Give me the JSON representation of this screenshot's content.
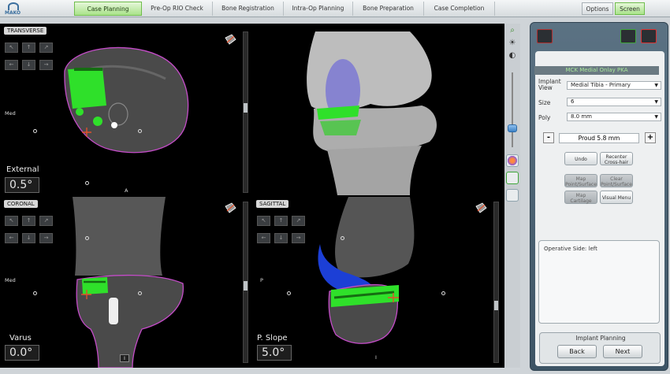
{
  "logo": {
    "text": "MAKO"
  },
  "tabs": [
    {
      "label": "Case Planning",
      "active": true
    },
    {
      "label": "Pre-Op RIO Check",
      "active": false
    },
    {
      "label": "Bone Registration",
      "active": false
    },
    {
      "label": "Intra-Op Planning",
      "active": false
    },
    {
      "label": "Bone Preparation",
      "active": false
    },
    {
      "label": "Case Completion",
      "active": false
    }
  ],
  "top_right": {
    "options_label": "Options",
    "screen_label": "Screen"
  },
  "views": {
    "transverse": {
      "label": "TRANSVERSE",
      "med": "Med",
      "bottom": "A",
      "angle_label": "External",
      "angle_value": "0.5°"
    },
    "coronal": {
      "label": "CORONAL",
      "med": "Med",
      "bottom": "I",
      "angle_label": "Varus",
      "angle_value": "0.0°"
    },
    "sagittal": {
      "label": "SAGITTAL",
      "side": "P",
      "bottom": "I",
      "angle_label": "P. Slope",
      "angle_value": "5.0°"
    }
  },
  "panel": {
    "implant_title": "MCK Medial Onlay PKA",
    "implant_view_label": "Implant View",
    "implant_view_value": "Medial Tibia - Primary",
    "size_label": "Size",
    "size_value": "6",
    "poly_label": "Poly",
    "poly_value": "8.0 mm",
    "minus": "-",
    "plus": "+",
    "proud_value": "Proud 5.8 mm",
    "undo": "Undo",
    "recenter": "Recenter Cross-hair",
    "map_point": "Map Point/Surface",
    "clear_point": "Clear Point/Surface",
    "map_cartilage": "Map Cartilage",
    "visual_menu": "Visual Menu",
    "operative_side": "Operative Side: left",
    "nav_title": "Implant Planning",
    "back": "Back",
    "next": "Next"
  },
  "colors": {
    "implant_green": "#2fe02a",
    "accent_blue": "#1c3fd6",
    "bone_outline": "#c44cc8"
  }
}
